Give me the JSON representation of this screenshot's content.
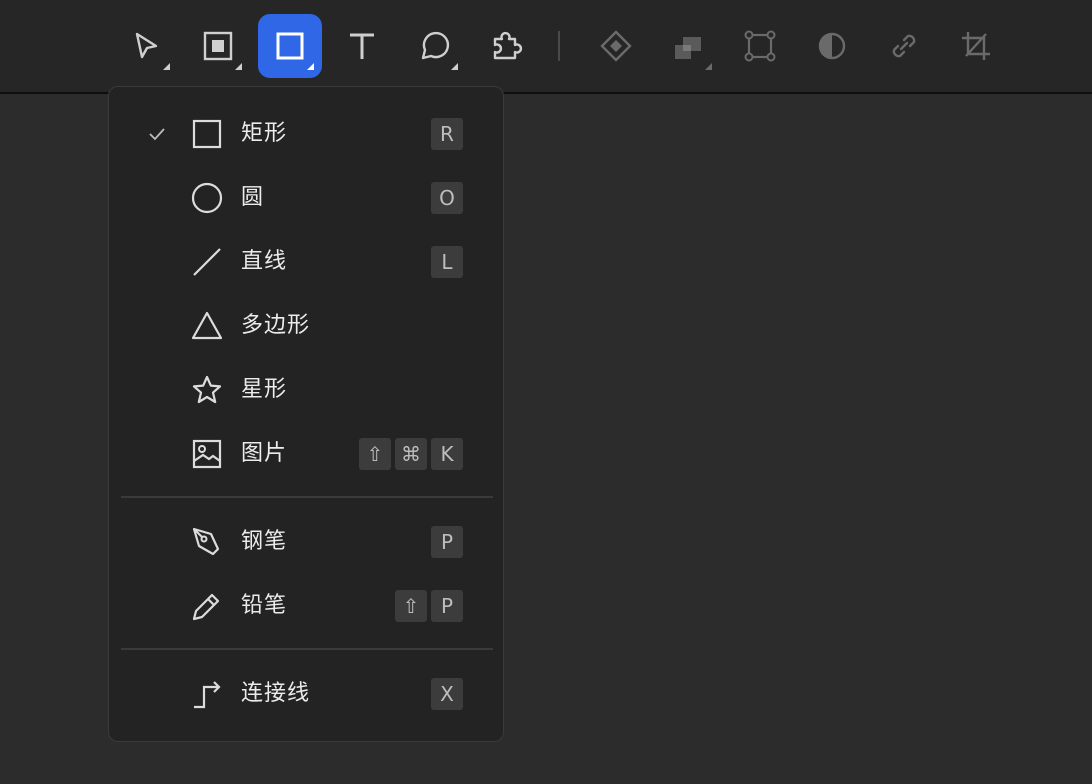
{
  "toolbar": {
    "tools": [
      {
        "name": "select-tool-button",
        "icon": "cursor-arrow-icon",
        "has_submenu": true
      },
      {
        "name": "frame-tool-button",
        "icon": "frame-icon",
        "has_submenu": true
      },
      {
        "name": "shape-tool-button",
        "icon": "square-icon",
        "has_submenu": true,
        "active": true
      },
      {
        "name": "text-tool-button",
        "icon": "text-t-icon",
        "has_submenu": false
      },
      {
        "name": "comment-tool-button",
        "icon": "speech-bubble-icon",
        "has_submenu": true
      },
      {
        "name": "plugins-tool-button",
        "icon": "puzzle-piece-icon",
        "has_submenu": false
      },
      {
        "name": "component-button",
        "icon": "component-diamond-icon",
        "has_submenu": false
      },
      {
        "name": "boolean-button",
        "icon": "boolean-union-icon",
        "has_submenu": true
      },
      {
        "name": "vector-edit-button",
        "icon": "vector-points-icon",
        "has_submenu": false
      },
      {
        "name": "mask-button",
        "icon": "mask-contrast-icon",
        "has_submenu": false
      },
      {
        "name": "link-button",
        "icon": "link-icon",
        "has_submenu": false
      },
      {
        "name": "crop-button",
        "icon": "crop-icon",
        "has_submenu": false
      }
    ],
    "active_color": "#2f67e6"
  },
  "menu": {
    "items": [
      {
        "label": "矩形",
        "icon": "rectangle-icon",
        "checked": true,
        "keys": [
          "R"
        ]
      },
      {
        "label": "圆",
        "icon": "circle-icon",
        "checked": false,
        "keys": [
          "O"
        ]
      },
      {
        "label": "直线",
        "icon": "line-icon",
        "checked": false,
        "keys": [
          "L"
        ]
      },
      {
        "label": "多边形",
        "icon": "triangle-polygon-icon",
        "checked": false,
        "keys": []
      },
      {
        "label": "星形",
        "icon": "star-icon",
        "checked": false,
        "keys": []
      },
      {
        "label": "图片",
        "icon": "image-icon",
        "checked": false,
        "keys": [
          "⇧",
          "⌘",
          "K"
        ]
      },
      {
        "label": "钢笔",
        "icon": "pen-nib-icon",
        "checked": false,
        "keys": [
          "P"
        ]
      },
      {
        "label": "铅笔",
        "icon": "pencil-icon",
        "checked": false,
        "keys": [
          "⇧",
          "P"
        ]
      },
      {
        "label": "连接线",
        "icon": "connector-arrow-icon",
        "checked": false,
        "keys": [
          "X"
        ]
      }
    ]
  }
}
